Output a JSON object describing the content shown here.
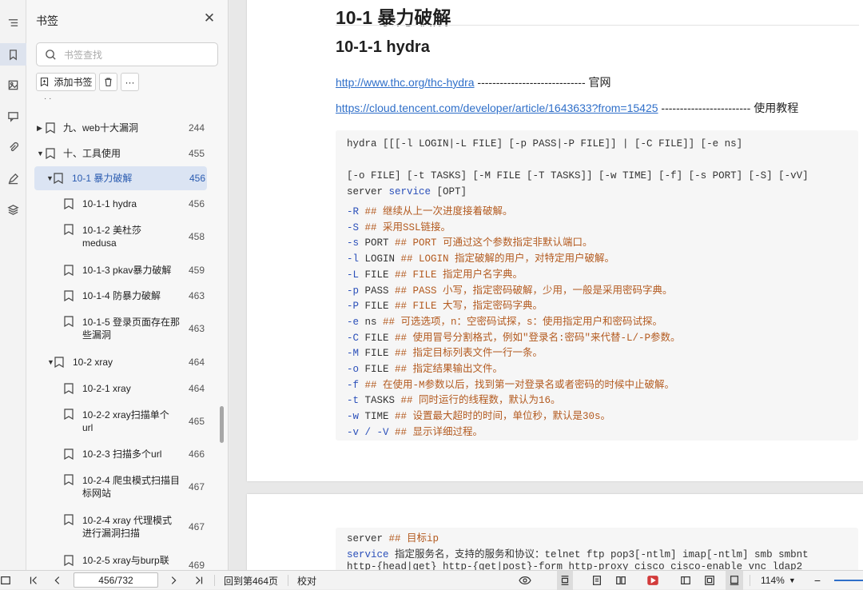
{
  "panel": {
    "title": "书签",
    "search_placeholder": "书签查找",
    "add_bookmark_label": "添加书签",
    "more_label": "···"
  },
  "bookmarks": [
    {
      "label": "九、web十大漏洞",
      "page": "244"
    },
    {
      "label": "十、工具使用",
      "page": "455"
    },
    {
      "label": "10-1 暴力破解",
      "page": "456"
    },
    {
      "label": "10-1-1 hydra",
      "page": "456"
    },
    {
      "label": "10-1-2 美杜莎",
      "label2": "medusa",
      "page": "458"
    },
    {
      "label": "10-1-3 pkav暴力破解",
      "page": "459"
    },
    {
      "label": "10-1-4 防暴力破解",
      "page": "463"
    },
    {
      "label": "10-1-5 登录页面存在那",
      "label2": "些漏洞",
      "page": "463"
    },
    {
      "label": "10-2 xray",
      "page": "464"
    },
    {
      "label": "10-2-1 xray",
      "page": "464"
    },
    {
      "label": "10-2-2 xray扫描单个",
      "label2": "url",
      "page": "465"
    },
    {
      "label": "10-2-3 扫描多个url",
      "page": "466"
    },
    {
      "label": "10-2-4 爬虫模式扫描目",
      "label2": "标网站",
      "page": "467"
    },
    {
      "label": "10-2-4 xray 代理模式",
      "label2": "进行漏洞扫描",
      "page": "467"
    },
    {
      "label": "10-2-5 xray与burp联",
      "page": "469"
    }
  ],
  "doc": {
    "h1": "10-1 暴力破解",
    "h2": "10-1-1 hydra",
    "link1": {
      "url": "http://www.thc.org/thc-hydra",
      "suffix": " ----------------------------- 官网"
    },
    "link2": {
      "url": "https://cloud.tencent.com/developer/article/1643633?from=15425",
      "suffix": " ------------------------ 使用教程"
    },
    "code": {
      "l1": "hydra [[[-l LOGIN|-L FILE] [-p PASS|-P FILE]] | [-C FILE]] [-e ns]",
      "l2": "[-o FILE] [-t TASKS] [-M FILE [-T TASKS]] [-w TIME] [-f] [-s PORT] [-S] [-vV]",
      "l3a": "server ",
      "l3b": "service",
      "l3c": " [OPT]",
      "opts": [
        {
          "flag": "-R",
          "arg": "",
          "desc": "## 继续从上一次进度接着破解。"
        },
        {
          "flag": "-S",
          "arg": "",
          "desc": "## 采用SSL链接。"
        },
        {
          "flag": "-s",
          "arg": " PORT",
          "desc": "## PORT 可通过这个参数指定非默认端口。"
        },
        {
          "flag": "-l",
          "arg": " LOGIN",
          "desc": "## LOGIN 指定破解的用户，对特定用户破解。"
        },
        {
          "flag": "-L",
          "arg": " FILE",
          "desc": "## FILE 指定用户名字典。"
        },
        {
          "flag": "-p",
          "arg": " PASS",
          "desc": "## PASS 小写，指定密码破解，少用，一般是采用密码字典。"
        },
        {
          "flag": "-P",
          "arg": " FILE",
          "desc": "## FILE 大写，指定密码字典。"
        },
        {
          "flag": "-e",
          "arg": " ns",
          "desc": "## 可选选项，n：空密码试探，s：使用指定用户和密码试探。"
        },
        {
          "flag": "-C",
          "arg": " FILE",
          "desc": "## 使用冒号分割格式，例如\"登录名:密码\"来代替-L/-P参数。"
        },
        {
          "flag": "-M",
          "arg": " FILE",
          "desc": "## 指定目标列表文件一行一条。"
        },
        {
          "flag": "-o",
          "arg": " FILE",
          "desc": "## 指定结果输出文件。"
        },
        {
          "flag": "-f",
          "arg": "",
          "desc": "## 在使用-M参数以后，找到第一对登录名或者密码的时候中止破解。"
        },
        {
          "flag": "-t",
          "arg": " TASKS",
          "desc": "## 同时运行的线程数，默认为16。"
        },
        {
          "flag": "-w",
          "arg": " TIME",
          "desc": "## 设置最大超时的时间，单位秒，默认是30s。"
        },
        {
          "flag": "-v / -V",
          "arg": "",
          "desc": "## 显示详细过程。"
        }
      ]
    },
    "page2": {
      "l1a": "server ",
      "l1b": "## 目标ip",
      "l2a": "service",
      "l2b": " 指定服务名，支持的服务和协议：telnet ftp pop3[-ntlm] imap[-ntlm] smb smbnt",
      "l3": "http-{head|get} http-{get|post}-form http-proxy cisco cisco-enable vnc ldap2"
    }
  },
  "status": {
    "page_value": "456/732",
    "back_label": "回到第464页",
    "proof_label": "校对",
    "zoom": "114%"
  },
  "colors": {
    "accent": "#2f6fc9",
    "keyword": "#2a4fb9",
    "comment": "#b35a1f",
    "selected_bg": "#dbe4f3"
  }
}
